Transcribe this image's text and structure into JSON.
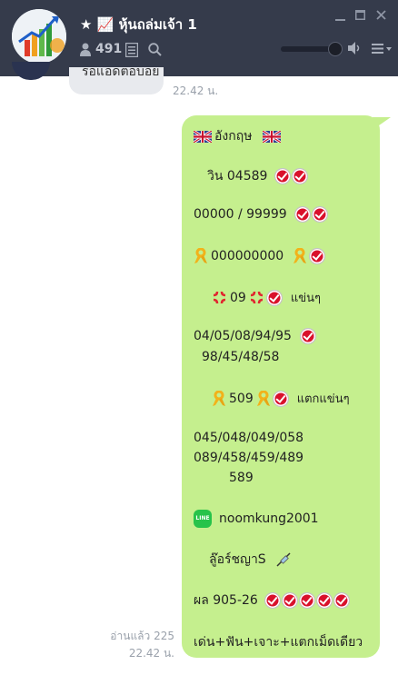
{
  "header": {
    "title": "★ 📈 หุ้นถล่มเจ้า 1",
    "member_count": "491"
  },
  "previous_message": {
    "text": "รอแอดตอบอย",
    "time": "22.42 น."
  },
  "message": {
    "lines": {
      "l1": "อังกฤษ",
      "l2": "วิน 04589",
      "l3": "00000 / 99999",
      "l4": "000000000",
      "l5a": "09",
      "l5b": "แข่นๆ",
      "l6": "04/05/08/94/95",
      "l7": "98/45/48/58",
      "l8a": "509",
      "l8b": "แตกแข่นๆ",
      "l9": "045/048/049/058",
      "l10": "089/458/459/489",
      "l11": "589",
      "l12": "noomkung2001",
      "l13": "ลู๊อร์ชญาS",
      "l14": "ผล 905-26",
      "l15": "เด่น+ฟัน+เจาะ+แตกเม็ดเดียว"
    },
    "read_label": "อ่านแล้ว 225",
    "time": "22.42 น."
  }
}
